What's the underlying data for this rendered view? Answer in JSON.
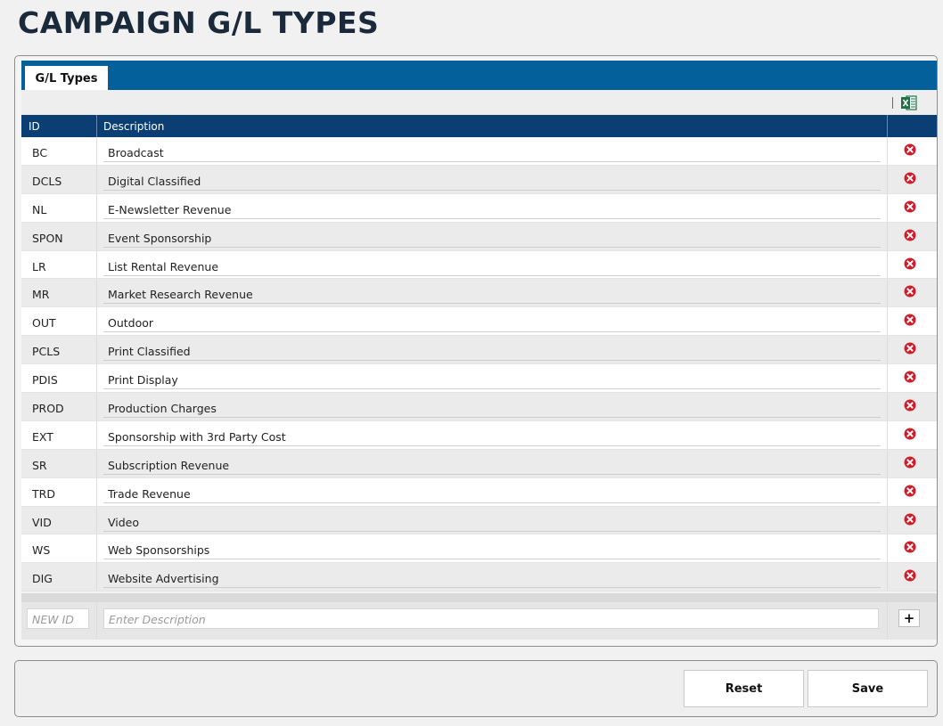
{
  "page": {
    "title": "CAMPAIGN G/L TYPES"
  },
  "tabs": [
    {
      "label": "G/L Types",
      "active": true
    }
  ],
  "toolbar": {
    "export_icon": "excel-icon"
  },
  "grid": {
    "columns": [
      "ID",
      "Description"
    ],
    "rows": [
      {
        "id": "BC",
        "description": "Broadcast"
      },
      {
        "id": "DCLS",
        "description": "Digital Classified"
      },
      {
        "id": "NL",
        "description": "E-Newsletter Revenue"
      },
      {
        "id": "SPON",
        "description": "Event Sponsorship"
      },
      {
        "id": "LR",
        "description": "List Rental Revenue"
      },
      {
        "id": "MR",
        "description": "Market Research Revenue"
      },
      {
        "id": "OUT",
        "description": "Outdoor"
      },
      {
        "id": "PCLS",
        "description": "Print Classified"
      },
      {
        "id": "PDIS",
        "description": "Print Display"
      },
      {
        "id": "PROD",
        "description": "Production Charges"
      },
      {
        "id": "EXT",
        "description": "Sponsorship with 3rd Party Cost"
      },
      {
        "id": "SR",
        "description": "Subscription Revenue"
      },
      {
        "id": "TRD",
        "description": "Trade Revenue"
      },
      {
        "id": "VID",
        "description": "Video"
      },
      {
        "id": "WS",
        "description": "Web Sponsorships"
      },
      {
        "id": "DIG",
        "description": "Website Advertising"
      }
    ],
    "delete_icon": "delete-icon"
  },
  "new_row": {
    "id_placeholder": "NEW ID",
    "description_placeholder": "Enter Description",
    "add_label": "+"
  },
  "footer": {
    "reset_label": "Reset",
    "save_label": "Save"
  },
  "colors": {
    "tab_strip": "#03609a",
    "grid_header": "#0b3f73",
    "delete": "#cc1f2b",
    "excel": "#1e7145"
  }
}
